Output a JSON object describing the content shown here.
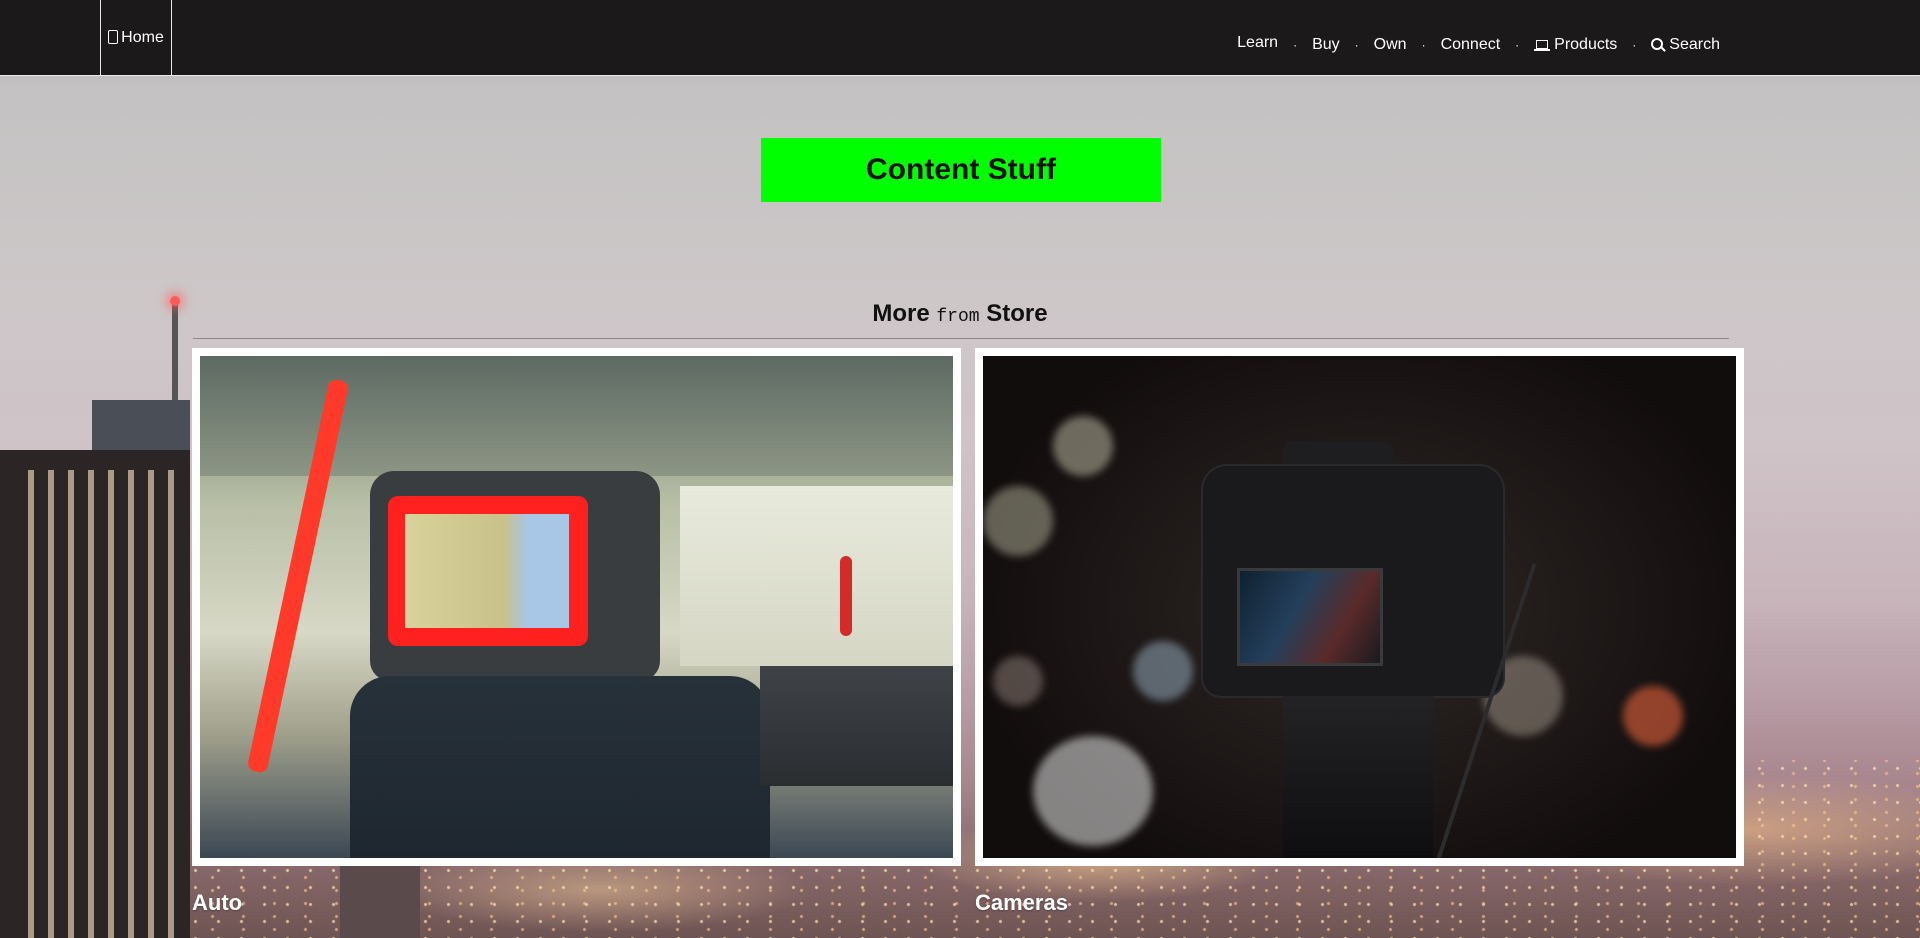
{
  "nav": {
    "home_label": "Home",
    "links": [
      {
        "label": "Learn"
      },
      {
        "label": "Buy"
      },
      {
        "label": "Own"
      },
      {
        "label": "Connect"
      },
      {
        "label": "Products",
        "icon": "laptop-icon"
      },
      {
        "label": "Search",
        "icon": "search-icon"
      }
    ],
    "separator": "·"
  },
  "hero": {
    "button_label": "Content Stuff",
    "button_color": "#00ff00"
  },
  "section": {
    "title_before": "More",
    "title_mono": "from",
    "title_after": "Store"
  },
  "cards": [
    {
      "caption": "Auto",
      "image": "car-interior-with-headrest-screen"
    },
    {
      "caption": "Cameras",
      "image": "dslr-camera-on-tripod"
    }
  ],
  "colors": {
    "nav_bg": "#1c191a",
    "accent": "#00ff00",
    "card_border": "#ffffff"
  }
}
